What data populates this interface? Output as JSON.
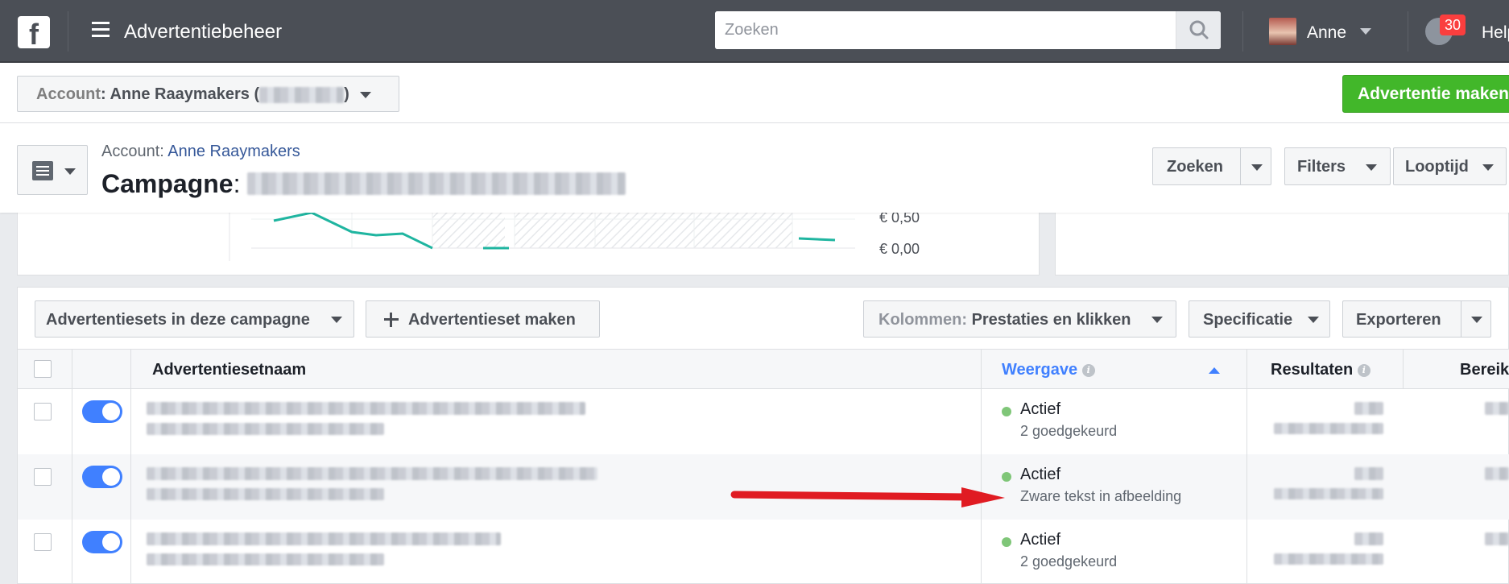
{
  "topbar": {
    "logo": "f",
    "app_title": "Advertentiebeheer",
    "search_placeholder": "Zoeken",
    "user_name": "Anne",
    "notifications": "30",
    "help_label": "Help"
  },
  "account_bar": {
    "account_label": "Account",
    "account_name": ": Anne Raaymakers (",
    "account_name_end": ")",
    "create_ad_label": "Advertentie maken"
  },
  "campaign_header": {
    "account_prefix": "Account: ",
    "account_link": "Anne Raaymakers",
    "campaign_label": "Campagne",
    "campaign_colon": ": ",
    "search_label": "Zoeken",
    "filters_label": "Filters",
    "duration_label": "Looptijd"
  },
  "chart": {
    "y_labels": [
      "€ 0,50",
      "€ 0,00"
    ]
  },
  "toolbar": {
    "adsets_dropdown": "Advertentiesets in deze campagne",
    "create_adset": "Advertentieset maken",
    "columns_label": "Kolommen:",
    "columns_value": "Prestaties en klikken",
    "breakdown_label": "Specificatie",
    "export_label": "Exporteren"
  },
  "table": {
    "headers": {
      "name": "Advertentiesetnaam",
      "delivery": "Weergave",
      "results": "Resultaten",
      "reach": "Bereik"
    },
    "rows": [
      {
        "status": "Actief",
        "substatus": "2 goedgekeurd"
      },
      {
        "status": "Actief",
        "substatus": "Zware tekst in afbeelding"
      },
      {
        "status": "Actief",
        "substatus": "2 goedgekeurd"
      }
    ]
  },
  "colors": {
    "topbar": "#4b4f56",
    "accent_blue": "#4080ff",
    "create_green": "#42b72a",
    "status_active": "#7fc678",
    "annotation_arrow": "#e01b22",
    "chart_line": "#1fb5a0"
  }
}
